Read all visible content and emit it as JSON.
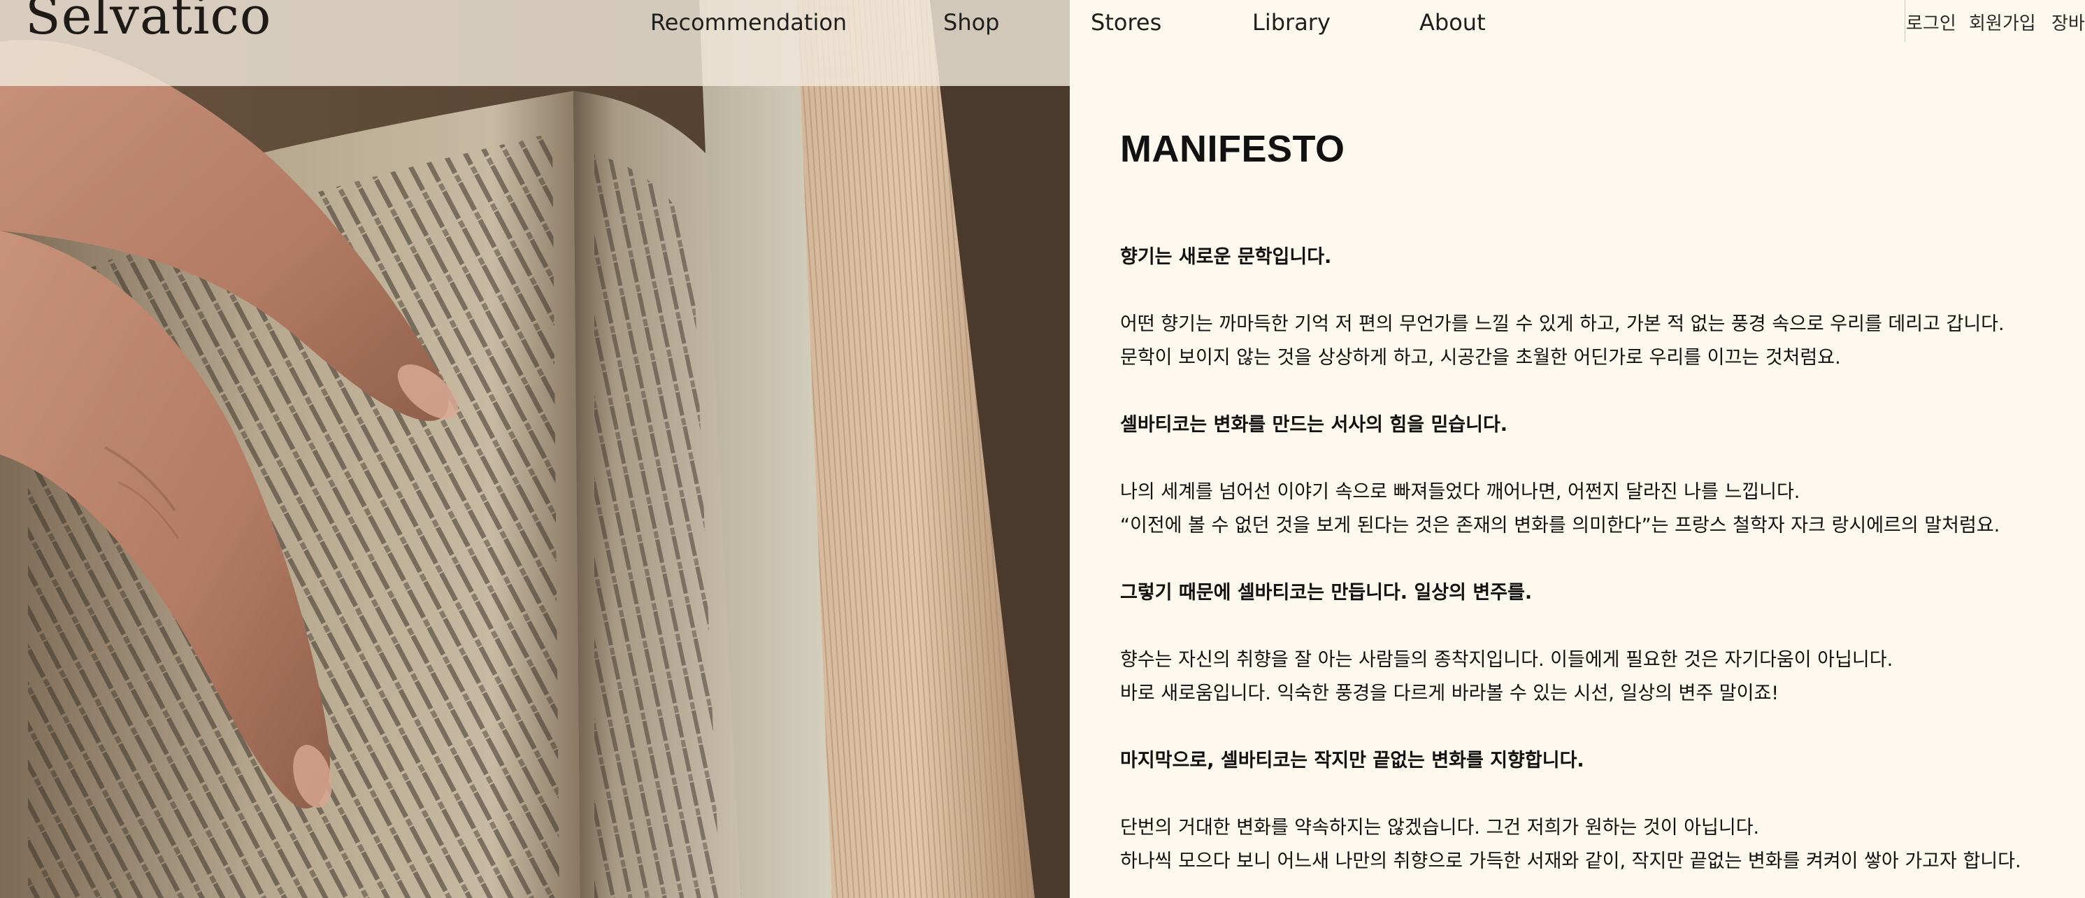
{
  "brand": {
    "logo": "Selvatico"
  },
  "nav": {
    "items": [
      {
        "label": "Recommendation"
      },
      {
        "label": "Shop"
      },
      {
        "label": "Stores"
      },
      {
        "label": "Library"
      },
      {
        "label": "About"
      }
    ]
  },
  "utility": {
    "login": "로그인",
    "signup": "회원가입",
    "cart": "장바"
  },
  "manifesto": {
    "title": "MANIFESTO",
    "sections": [
      {
        "heading": "향기는 새로운 문학입니다.",
        "lines": [
          "어떤 향기는 까마득한 기억 저 편의 무언가를 느낄 수 있게 하고, 가본 적 없는 풍경 속으로 우리를 데리고 갑니다.",
          "문학이 보이지 않는 것을 상상하게 하고, 시공간을 초월한 어딘가로 우리를 이끄는 것처럼요."
        ]
      },
      {
        "heading": "셀바티코는 변화를 만드는 서사의 힘을 믿습니다.",
        "lines": [
          "나의 세계를 넘어선 이야기 속으로 빠져들었다 깨어나면, 어쩐지 달라진 나를 느낍니다.",
          "“이전에 볼 수 없던 것을 보게 된다는 것은 존재의 변화를 의미한다”는 프랑스 철학자 자크 랑시에르의 말처럼요."
        ]
      },
      {
        "heading": "그렇기 때문에 셀바티코는 만듭니다. 일상의 변주를.",
        "lines": [
          "향수는 자신의 취향을 잘 아는 사람들의 종착지입니다. 이들에게 필요한 것은 자기다움이 아닙니다.",
          "바로 새로움입니다. 익숙한 풍경을 다르게 바라볼 수 있는 시선, 일상의 변주 말이죠!"
        ]
      },
      {
        "heading": "마지막으로, 셀바티코는 작지만 끝없는 변화를 지향합니다.",
        "lines": [
          "단번의 거대한 변화를 약속하지는 않겠습니다. 그건 저희가 원하는 것이 아닙니다.",
          "하나씩 모으다 보니 어느새 나만의 취향으로 가득한 서재와 같이, 작지만 끝없는 변화를 켜켜이 쌓아 가고자 합니다."
        ]
      }
    ]
  },
  "colors": {
    "background": "#fdf9ee",
    "text": "#111111",
    "header_overlay": "#f0e8da"
  }
}
